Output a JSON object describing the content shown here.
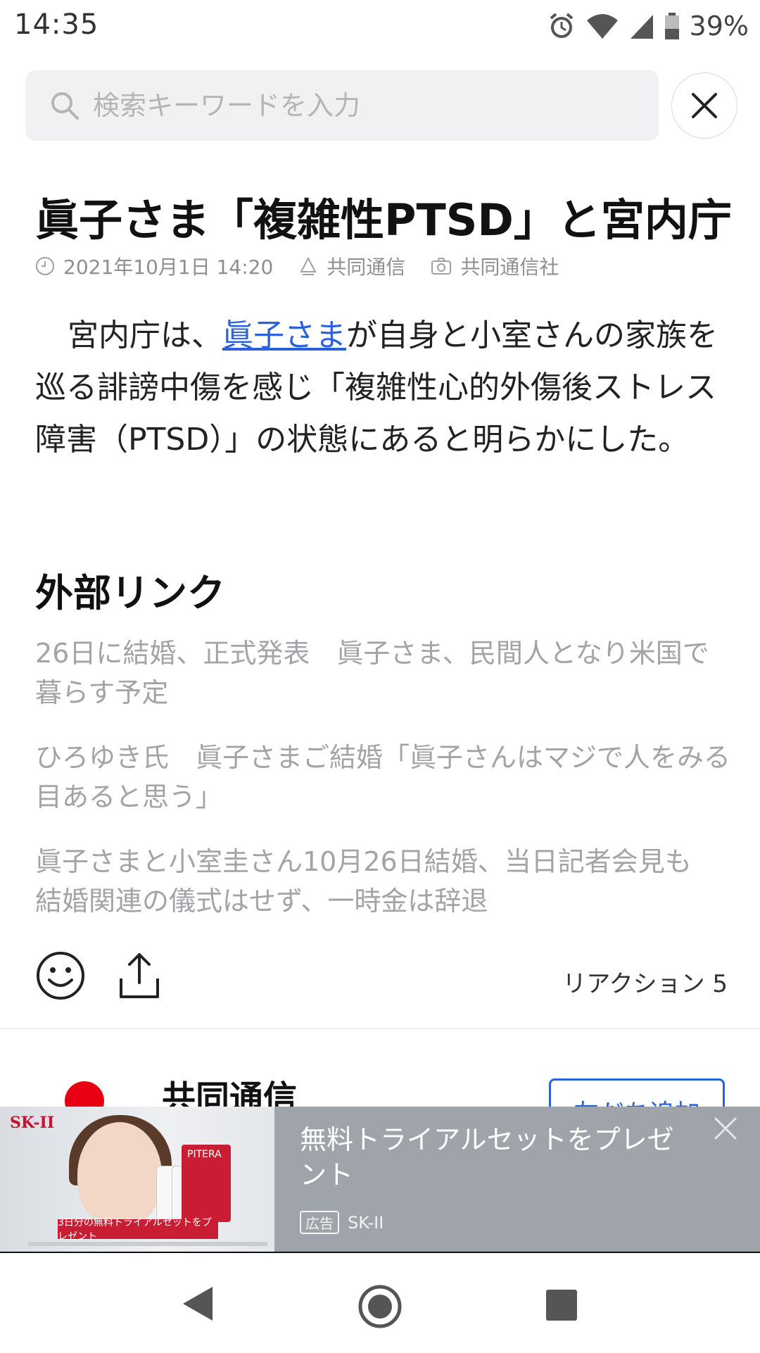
{
  "status_bar": {
    "time": "14:35",
    "battery": "39%"
  },
  "search": {
    "placeholder": "検索キーワードを入力"
  },
  "article": {
    "title": "眞子さま「複雑性PTSD」と宮内庁",
    "date": "2021年10月1日 14:20",
    "source": "共同通信",
    "photo_credit": "共同通信社",
    "body_before_link": "宮内庁は、",
    "body_link": "眞子さま",
    "body_after_link": "が自身と小室さんの家族を巡る誹謗中傷を感じ「複雑性心的外傷後ストレス障害（PTSD）」の状態にあると明らかにした。"
  },
  "external_links": {
    "heading": "外部リンク",
    "items": [
      "26日に結婚、正式発表　眞子さま、民間人となり米国で暮らす予定",
      "ひろゆき氏　眞子さまご結婚「眞子さんはマジで人をみる目あると思う」",
      "眞子さまと小室圭さん10月26日結婚、当日記者会見も　結婚関連の儀式はせず、一時金は辞退"
    ]
  },
  "reactions": {
    "label": "リアクション 5"
  },
  "publisher": {
    "name": "共同通信",
    "follow_label": "友だち追加"
  },
  "ad": {
    "headline": "無料トライアルセットをプレゼント",
    "tag": "広告",
    "advertiser": "SK-II",
    "image_brand": "SK-II",
    "image_product": "PITERA",
    "image_caption": "3日分の無料トライアルセットをプレゼント"
  },
  "colors": {
    "link": "#2b62d9",
    "ad_background": "#9ea4aa",
    "brand_red": "#e60012"
  },
  "icons": [
    "search-icon",
    "close-icon",
    "clock-icon",
    "source-icon",
    "camera-icon",
    "smile-icon",
    "share-icon",
    "back-icon",
    "home-icon",
    "recent-icon"
  ]
}
